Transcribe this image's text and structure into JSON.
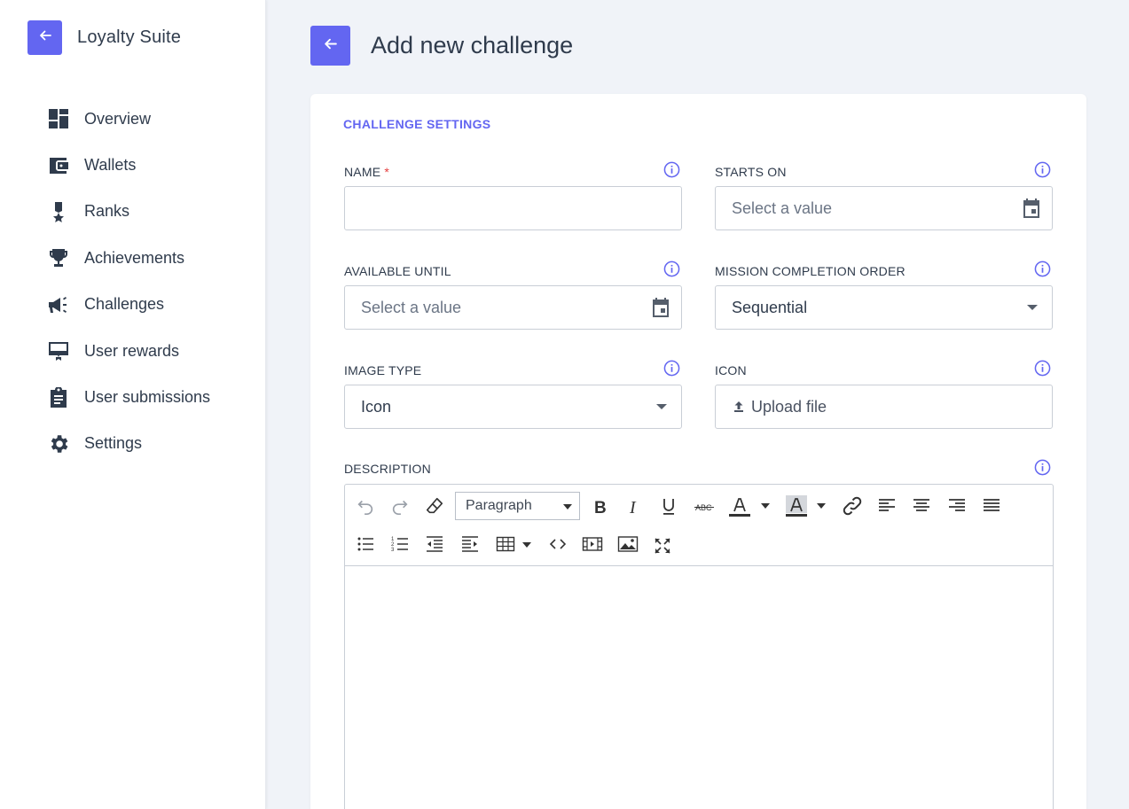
{
  "sidebar": {
    "brand": "Loyalty Suite",
    "items": [
      {
        "label": "Overview",
        "icon": "dashboard-icon"
      },
      {
        "label": "Wallets",
        "icon": "wallet-icon"
      },
      {
        "label": "Ranks",
        "icon": "medal-icon"
      },
      {
        "label": "Achievements",
        "icon": "trophy-icon"
      },
      {
        "label": "Challenges",
        "icon": "megaphone-icon"
      },
      {
        "label": "User rewards",
        "icon": "reward-card-icon"
      },
      {
        "label": "User submissions",
        "icon": "clipboard-icon"
      },
      {
        "label": "Settings",
        "icon": "gear-icon"
      }
    ]
  },
  "page": {
    "title": "Add new challenge"
  },
  "form": {
    "section_title": "CHALLENGE SETTINGS",
    "name": {
      "label": "NAME",
      "required_mark": "*",
      "value": ""
    },
    "starts_on": {
      "label": "STARTS ON",
      "placeholder": "Select a value"
    },
    "available_until": {
      "label": "AVAILABLE UNTIL",
      "placeholder": "Select a value"
    },
    "mission_order": {
      "label": "MISSION COMPLETION ORDER",
      "value": "Sequential"
    },
    "image_type": {
      "label": "IMAGE TYPE",
      "value": "Icon"
    },
    "icon": {
      "label": "ICON",
      "upload_label": "Upload file"
    },
    "description": {
      "label": "DESCRIPTION",
      "paragraph_select": "Paragraph"
    }
  },
  "colors": {
    "accent": "#6366f1",
    "text": "#2f3b4c",
    "required": "#e53e3e",
    "background": "#f0f3f8"
  }
}
